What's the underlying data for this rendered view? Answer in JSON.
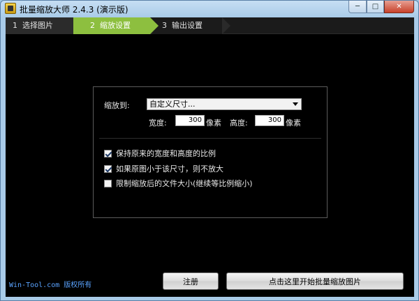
{
  "window": {
    "title": "批量缩放大师 2.4.3 (演示版)",
    "min_symbol": "─",
    "max_symbol": "□",
    "close_symbol": "✕"
  },
  "steps": [
    {
      "num": "1",
      "label": "选择图片"
    },
    {
      "num": "2",
      "label": "缩放设置"
    },
    {
      "num": "3",
      "label": "输出设置"
    }
  ],
  "active_step": 2,
  "panel": {
    "scale_to_label": "缩放到:",
    "scale_to_value": "自定义尺寸...",
    "width_label": "宽度:",
    "width_value": "300",
    "width_unit": "像素",
    "height_label": "高度:",
    "height_value": "300",
    "height_unit": "像素",
    "options": [
      {
        "label": "保持原来的宽度和高度的比例",
        "checked": true
      },
      {
        "label": "如果原图小于该尺寸，则不放大",
        "checked": true
      },
      {
        "label": "限制缩放后的文件大小(继续等比例缩小)",
        "checked": false
      }
    ]
  },
  "footer": {
    "copyright": "Win-Tool.com 版权所有",
    "register_label": "注册",
    "start_label": "点击这里开始批量缩放图片"
  },
  "colors": {
    "active_step": "#8dbf3f",
    "link": "#5aa3ff"
  }
}
